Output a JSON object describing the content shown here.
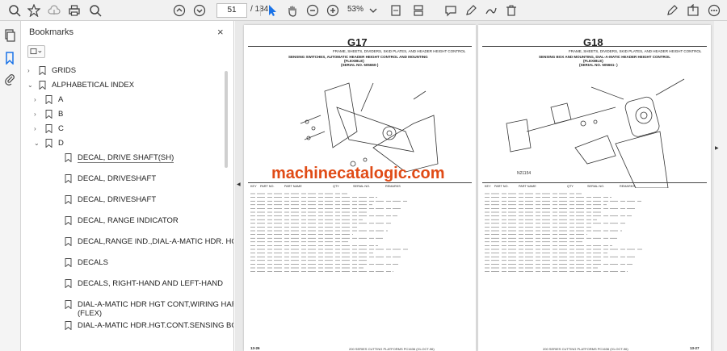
{
  "toolbar": {
    "current_page": "51",
    "total_pages": "/ 134",
    "zoom": "53%"
  },
  "panel": {
    "title": "Bookmarks",
    "close": "×"
  },
  "bookmarks": [
    {
      "label": "GRIDS",
      "level": 0,
      "chev": "›"
    },
    {
      "label": "ALPHABETICAL INDEX",
      "level": 0,
      "chev": "⌄"
    },
    {
      "label": "A",
      "level": 1,
      "chev": "›"
    },
    {
      "label": "B",
      "level": 1,
      "chev": "›"
    },
    {
      "label": "C",
      "level": 1,
      "chev": "›"
    },
    {
      "label": "D",
      "level": 1,
      "chev": "⌄"
    },
    {
      "label": "DECAL, DRIVE SHAFT(SH)",
      "level": 2,
      "chev": ""
    },
    {
      "label": "DECAL, DRIVESHAFT",
      "level": 2,
      "chev": ""
    },
    {
      "label": "DECAL, DRIVESHAFT",
      "level": 2,
      "chev": ""
    },
    {
      "label": "DECAL, RANGE INDICATOR",
      "level": 2,
      "chev": ""
    },
    {
      "label": "DECAL,RANGE IND.,DIAL-A-MATIC HDR. HGT.  CONT.",
      "level": 2,
      "chev": ""
    },
    {
      "label": "DECALS",
      "level": 2,
      "chev": ""
    },
    {
      "label": "DECALS, RIGHT-HAND AND LEFT-HAND",
      "level": 2,
      "chev": ""
    },
    {
      "label": "DIAL-A-MATIC HDR HGT CONT,WIRING HARNESS",
      "label2": "(FLEX)",
      "level": 2,
      "chev": ""
    },
    {
      "label": "DIAL-A-MATIC HDR.HGT.CONT.SENSING BOX",
      "level": 2,
      "chev": ""
    }
  ],
  "doc": {
    "left": {
      "code": "G17",
      "title1": "FRAME, SHEETS, DIVIDERS, SKID PLATES, AND HEADER HEIGHT CONTROL",
      "title2": "SENSING SWITCHES, AUTOMATIC HEADER HEIGHT CONTROL AND MOUNTING",
      "title3": "(FLEXIBLE)",
      "serial": "(SERIAL NO.       505660-)",
      "foot_left": "13-26",
      "foot_mid": "200 SERIES CUTTING PLATFORMS   PC1636    (01-OCT-96)"
    },
    "right": {
      "code": "G18",
      "title1": "FRAME, SHEETS, DIVIDERS, SKID PLATES, AND HEADER HEIGHT CONTROL",
      "title2": "SENSING BOX AND MOUNTING, DIAL-A-MATIC HEADER HEIGHT CONTROL",
      "title3": "(FLEXIBLE)",
      "serial": "(SERIAL NO. 505661-  )",
      "fig": "N21154",
      "foot_left": "200 SERIES CUTTING PLATFORMS   PC1636    (01-OCT-96)",
      "foot_right": "13-27"
    },
    "watermark": "machinecatalogic.com",
    "table_head": [
      "KEY",
      "PART NO.",
      "PART NAME",
      "QTY",
      "SERIAL NO.",
      "REMARKS"
    ]
  },
  "colors": {
    "watermark": "#e04b16",
    "accent": "#1a73e8"
  }
}
